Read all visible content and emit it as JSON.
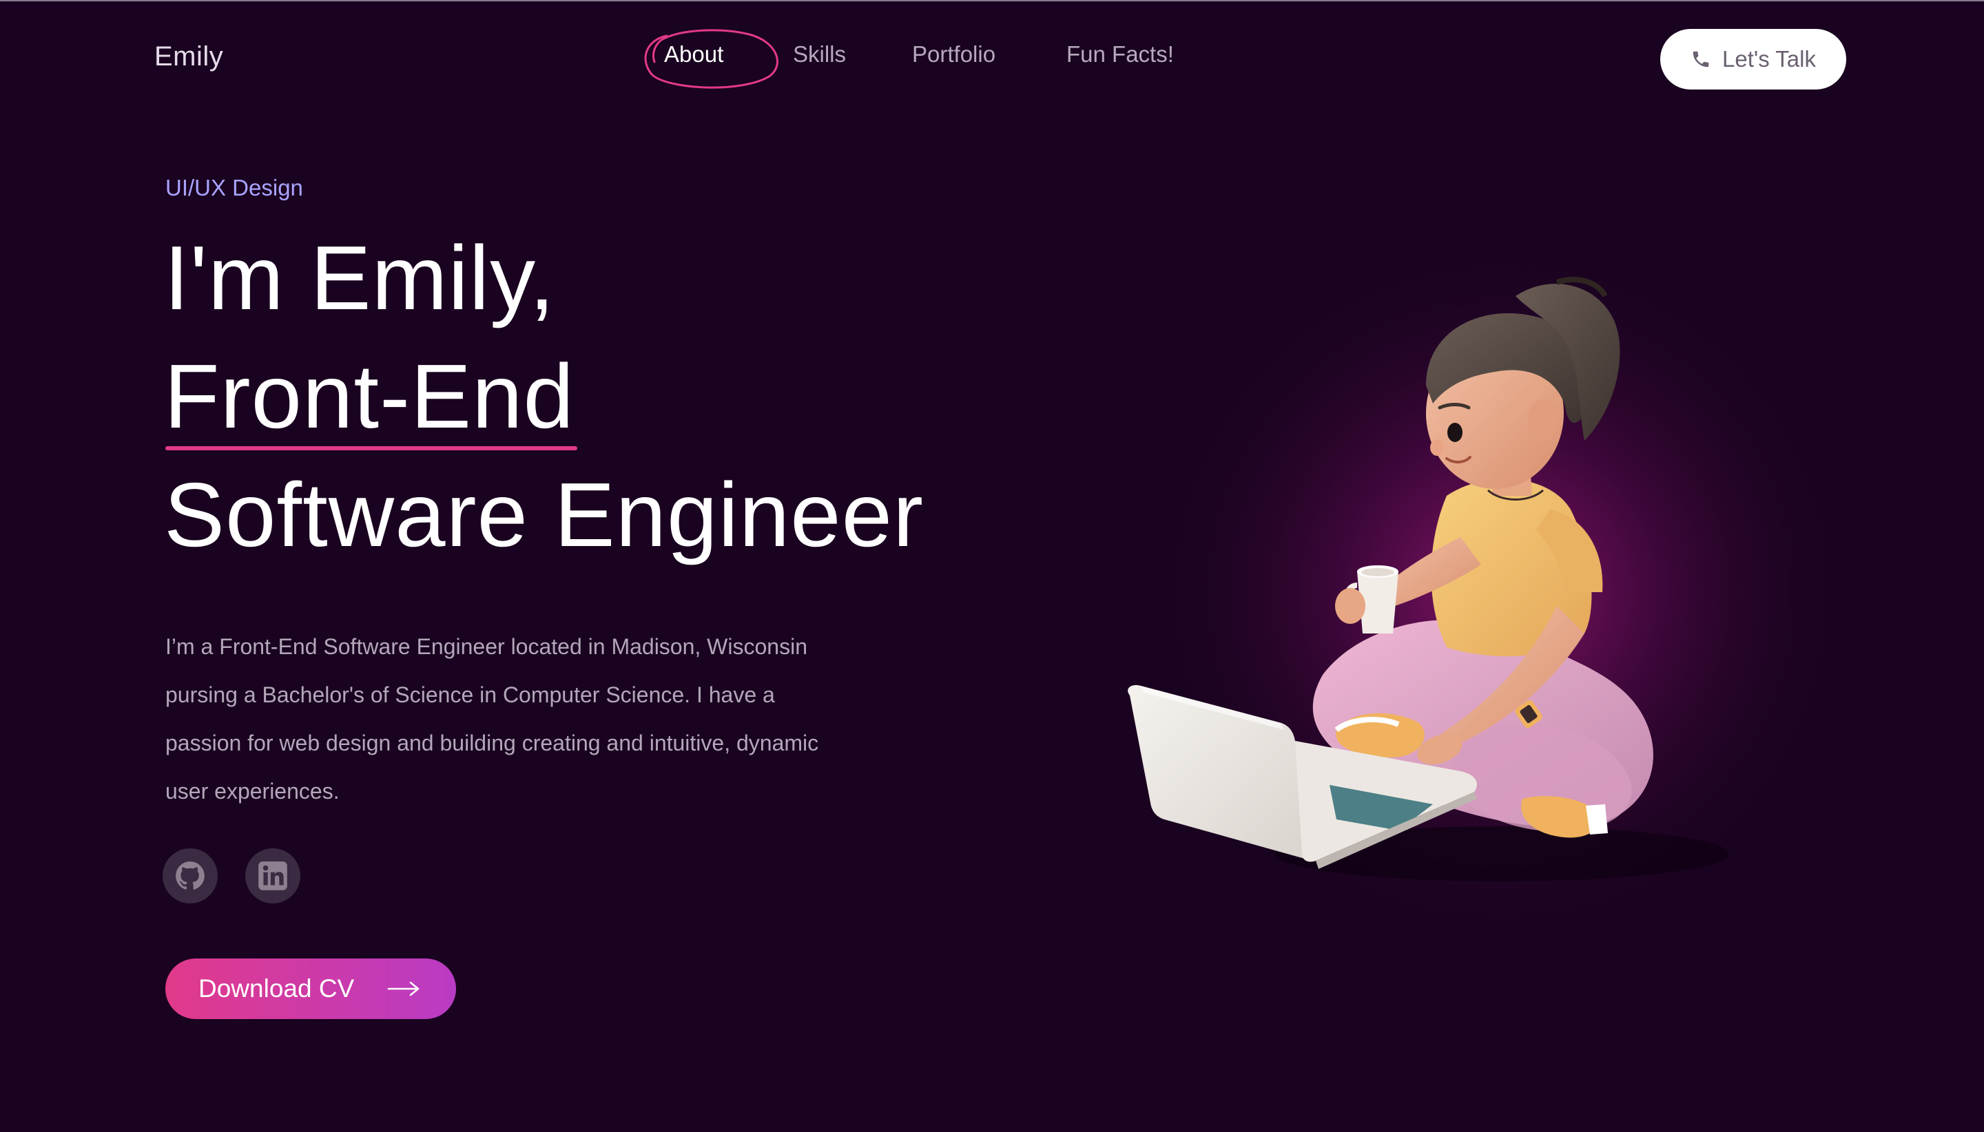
{
  "nav": {
    "brand": "Emily",
    "items": [
      {
        "label": "About",
        "active": true
      },
      {
        "label": "Skills",
        "active": false
      },
      {
        "label": "Portfolio",
        "active": false
      },
      {
        "label": "Fun Facts!",
        "active": false
      }
    ],
    "cta_label": "Let's Talk",
    "cta_icon": "phone-icon"
  },
  "hero": {
    "eyebrow": "UI/UX Design",
    "headline_line1": "I'm Emily,",
    "headline_line2": "Front-End",
    "headline_line3": "Software Engineer",
    "bio_line1": "I’m a Front-End Software Engineer located in Madison, Wisconsin",
    "bio_line2": "pursing a Bachelor's of Science in Computer Science. I have a",
    "bio_line3": "passion for web design and building creating and intuitive, dynamic",
    "bio_line4": "user experiences.",
    "socials": [
      {
        "icon": "github-icon"
      },
      {
        "icon": "linkedin-icon"
      }
    ],
    "cv_label": "Download CV",
    "cv_icon": "arrow-right-icon"
  },
  "colors": {
    "background": "#1a0320",
    "accent_pink": "#e23a86",
    "accent_purple": "#b93bc4",
    "eyebrow": "#a9a4ff",
    "body_text": "#b3a7b9"
  },
  "illustration": {
    "icon": "woman-with-laptop-illustration"
  }
}
